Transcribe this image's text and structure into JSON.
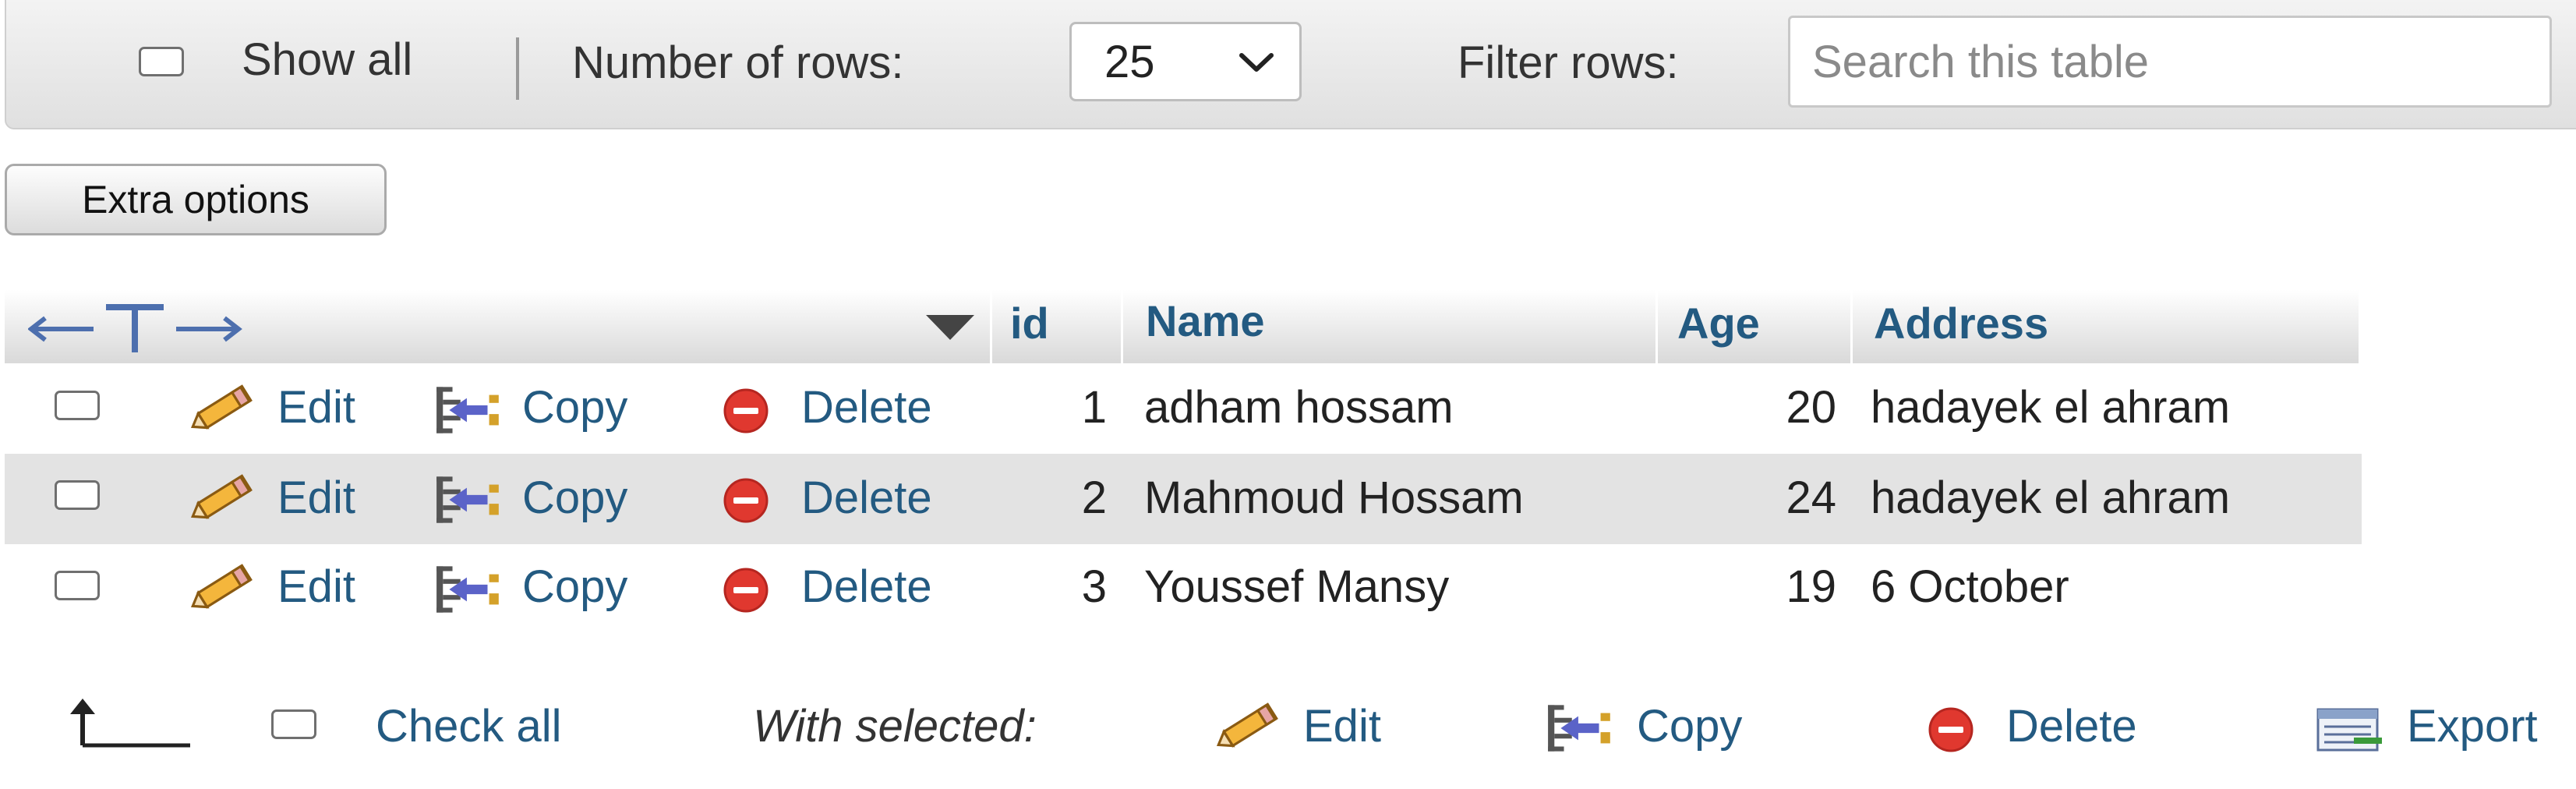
{
  "toolbar": {
    "show_all_label": "Show all",
    "rows_label": "Number of rows:",
    "rows_value": "25",
    "filter_label": "Filter rows:",
    "search_placeholder": "Search this table"
  },
  "extra_options_label": "Extra options",
  "table": {
    "columns": [
      "id",
      "Name",
      "Age",
      "Address"
    ],
    "actions": {
      "edit": "Edit",
      "copy": "Copy",
      "delete": "Delete"
    },
    "rows": [
      {
        "id": "1",
        "name": "adham hossam",
        "age": "20",
        "address": "hadayek el ahram"
      },
      {
        "id": "2",
        "name": "Mahmoud Hossam",
        "age": "24",
        "address": "hadayek el ahram"
      },
      {
        "id": "3",
        "name": "Youssef Mansy",
        "age": "19",
        "address": "6 October"
      }
    ]
  },
  "bottom": {
    "check_all_label": "Check all",
    "with_selected_label": "With selected:",
    "edit_label": "Edit",
    "copy_label": "Copy",
    "delete_label": "Delete",
    "export_label": "Export"
  },
  "colors": {
    "link": "#235a81",
    "delete_icon": "#e0382f",
    "row_highlight": "#e3e3e3"
  }
}
